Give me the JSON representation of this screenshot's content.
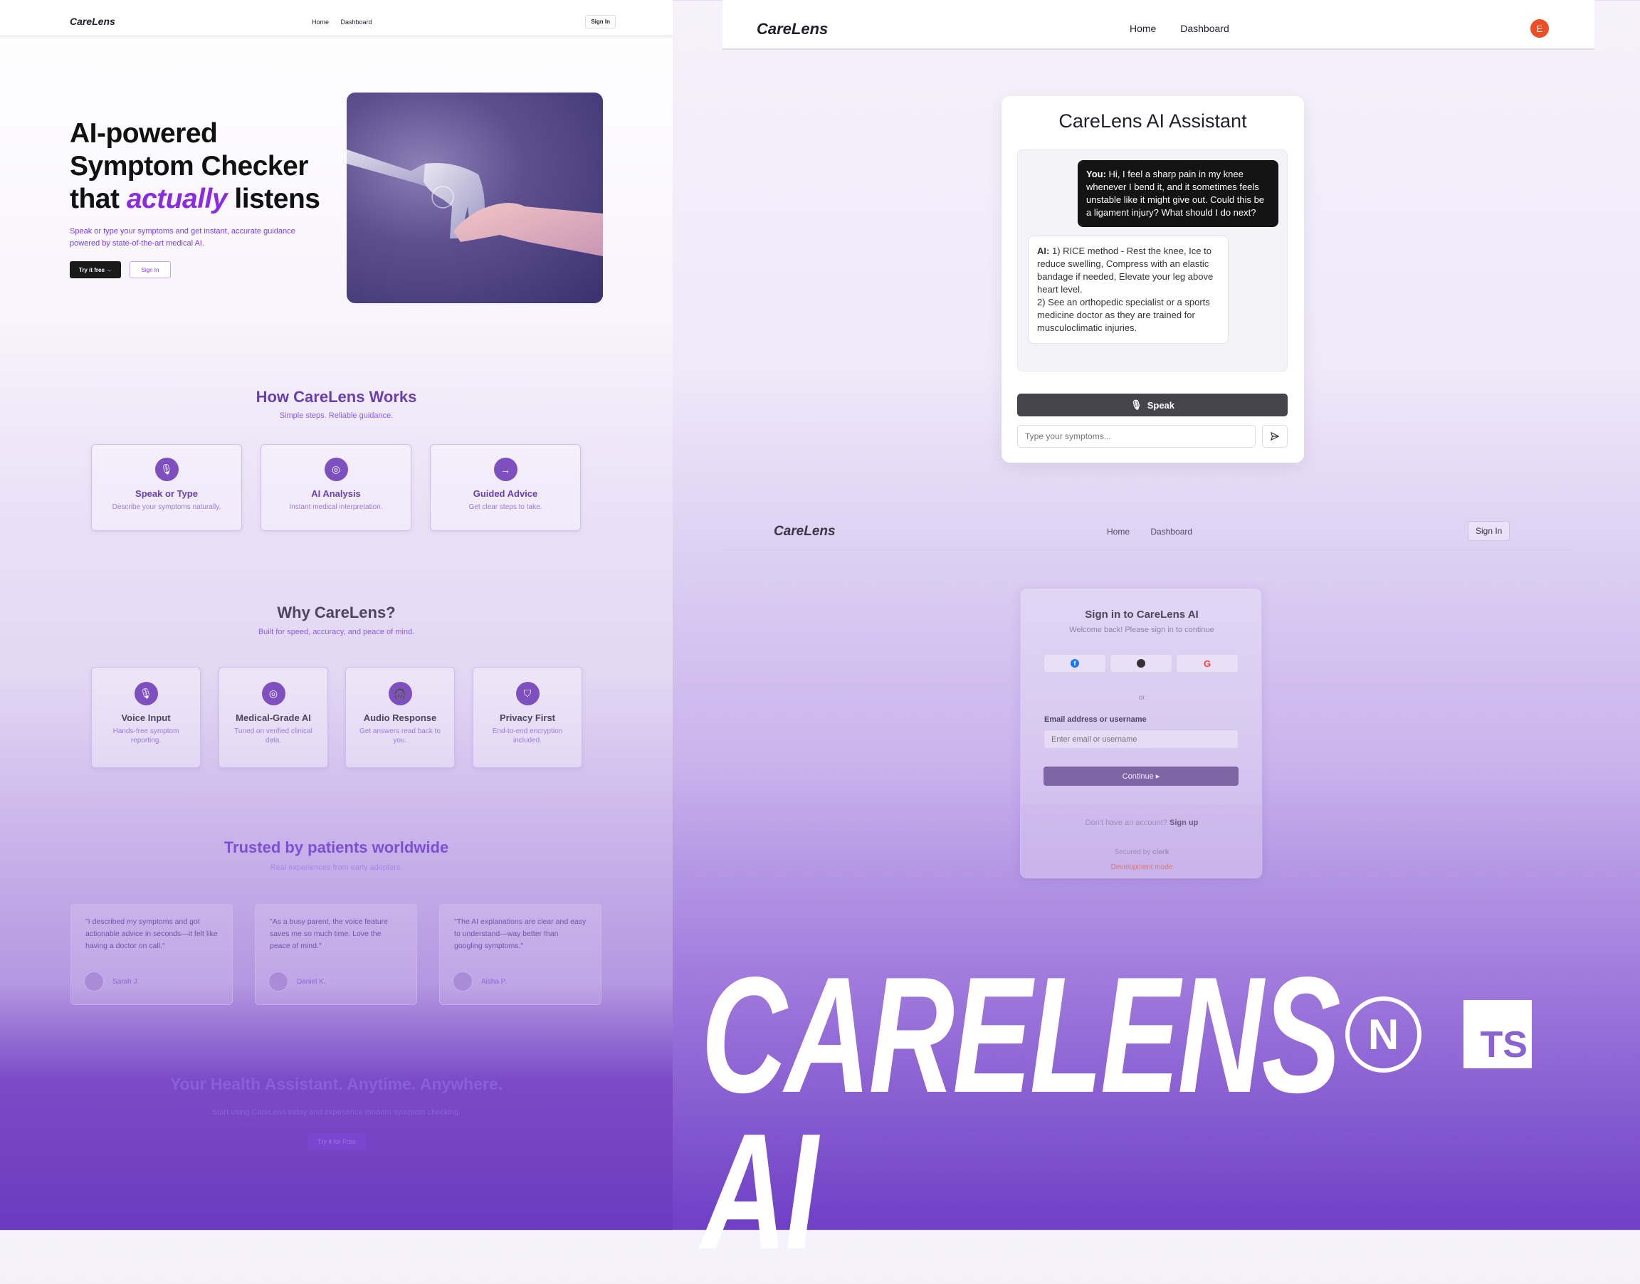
{
  "landing": {
    "nav": {
      "logo": "CareLens",
      "links": [
        "Home",
        "Dashboard"
      ],
      "signin": "Sign In"
    },
    "hero": {
      "title_line1": "AI-powered",
      "title_line2": "Symptom Checker",
      "title_line3_pre": "that ",
      "title_line3_accent": "actually",
      "title_line3_post": " listens",
      "subtitle": "Speak or type your symptoms and get instant, accurate guidance powered by state-of-the-art medical AI.",
      "try_button": "Try it free",
      "signin_button": "Sign In"
    },
    "how": {
      "title": "How CareLens Works",
      "subtitle": "Simple steps. Reliable guidance.",
      "cards": [
        {
          "icon": "mic-icon",
          "title": "Speak or Type",
          "desc": "Describe your symptoms naturally."
        },
        {
          "icon": "brain-icon",
          "title": "AI Analysis",
          "desc": "Instant medical interpretation."
        },
        {
          "icon": "arrow-right-icon",
          "title": "Guided Advice",
          "desc": "Get clear steps to take."
        }
      ]
    },
    "why": {
      "title": "Why CareLens?",
      "subtitle": "Built for speed, accuracy, and peace of mind.",
      "cards": [
        {
          "icon": "mic-icon",
          "title": "Voice Input",
          "desc": "Hands-free symptom reporting."
        },
        {
          "icon": "brain-icon",
          "title": "Medical-Grade AI",
          "desc": "Tuned on verified clinical data."
        },
        {
          "icon": "headphones-icon",
          "title": "Audio Response",
          "desc": "Get answers read back to you."
        },
        {
          "icon": "shield-icon",
          "title": "Privacy First",
          "desc": "End-to-end encryption included."
        }
      ]
    },
    "testimonials": {
      "title": "Trusted by patients worldwide",
      "subtitle": "Real experiences from early adopters.",
      "items": [
        {
          "quote": "\"I described my symptoms and got actionable advice in seconds—it felt like having a doctor on call.\"",
          "author": "Sarah J."
        },
        {
          "quote": "\"As a busy parent, the voice feature saves me so much time. Love the peace of mind.\"",
          "author": "Daniel K."
        },
        {
          "quote": "\"The AI explanations are clear and easy to understand—way better than googling symptoms.\"",
          "author": "Aisha P."
        }
      ]
    },
    "cta": {
      "title": "Your Health Assistant. Anytime. Anywhere.",
      "subtitle": "Start using CareLens today and experience modern symptom checking.",
      "button": "Try it for Free"
    }
  },
  "chat": {
    "nav": {
      "logo": "CareLens",
      "links": [
        "Home",
        "Dashboard"
      ],
      "avatar": "E"
    },
    "title": "CareLens AI Assistant",
    "user_prefix": "You:",
    "user_message": "Hi, I feel a sharp pain in my knee whenever I bend it, and it sometimes feels unstable like it might give out. Could this be a ligament injury? What should I do next?",
    "ai_prefix": "AI:",
    "ai_message": "1) RICE method - Rest the knee, Ice to reduce swelling, Compress with an elastic bandage if needed, Elevate your leg above heart level.\n2) See an orthopedic specialist or a sports medicine doctor as they are trained for musculoclimatic injuries.",
    "speak_button": "Speak",
    "input_placeholder": "Type your symptoms..."
  },
  "signin": {
    "nav": {
      "logo": "CareLens",
      "links": [
        "Home",
        "Dashboard"
      ],
      "signin": "Sign In"
    },
    "title": "Sign in to CareLens AI",
    "subtitle": "Welcome back! Please sign in to continue",
    "divider": "or",
    "email_label": "Email address or username",
    "email_placeholder": "Enter email or username",
    "continue": "Continue",
    "no_account": "Don't have an account?",
    "sign_up": "Sign up",
    "secured_by": "Secured by",
    "clerk": "clerk",
    "dev_mode": "Development mode"
  },
  "brand": {
    "wordmark": "CARELENS AI",
    "ts_badge": "TS",
    "next_badge": "N"
  },
  "colors": {
    "accent": "#7c3aed",
    "chat_dark": "#141414",
    "avatar": "#ef4e24"
  }
}
